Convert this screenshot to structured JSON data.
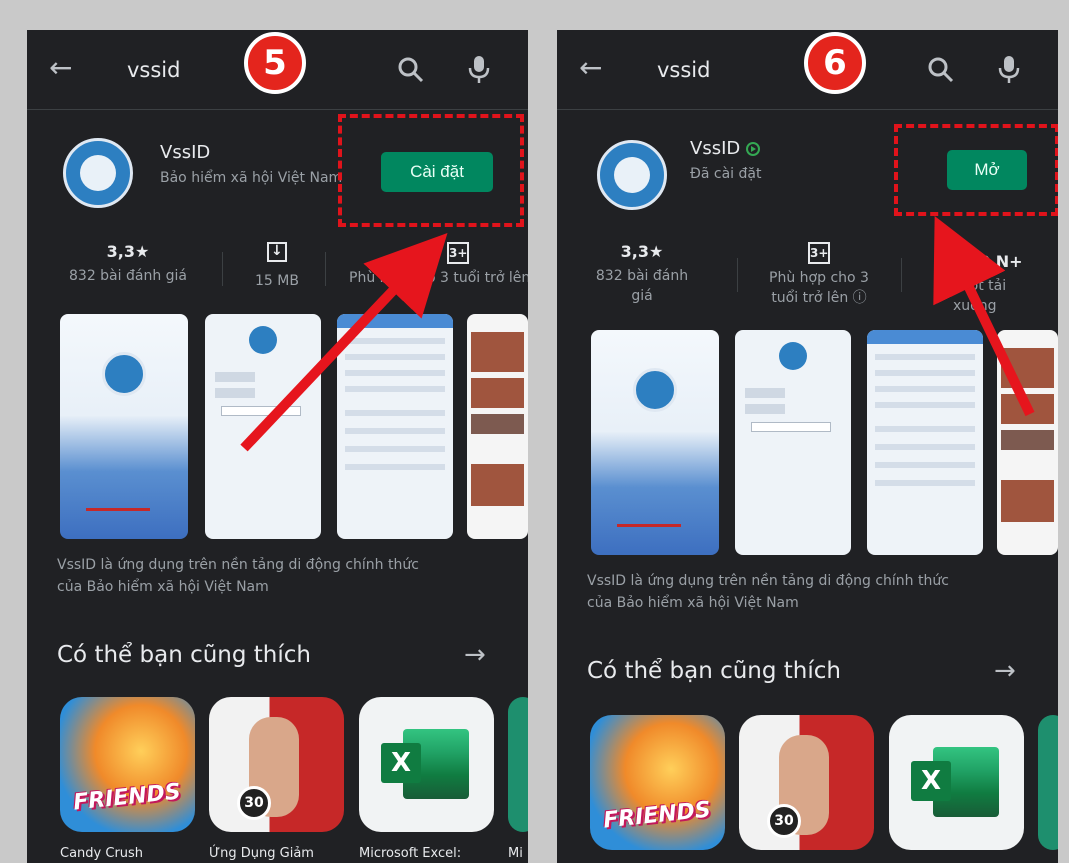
{
  "left": {
    "search_query": "vssid",
    "step": "5",
    "app_name": "VssID",
    "app_subtitle": "Bảo hiểm xã hội Việt Nam",
    "action_label": "Cài đặt",
    "rating": "3,3★",
    "reviews": "832 bài đánh giá",
    "size": "15 MB",
    "age_rating": "3+",
    "age_text": "Phù hợp cho 3 tuổi trở lên",
    "description_line1": "VssID là ứng dụng trên nền tảng di động chính thức",
    "description_line2": "của Bảo hiểm xã hội Việt Nam",
    "section_title": "Có thể bạn cũng thích",
    "recs": [
      "Candy Crush",
      "Ứng Dụng Giảm",
      "Microsoft Excel:",
      "Mi"
    ]
  },
  "right": {
    "search_query": "vssid",
    "step": "6",
    "app_name": "VssID",
    "app_subtitle": "Đã cài đặt",
    "action_label": "Mở",
    "rating": "3,3★",
    "reviews_line1": "832 bài đánh",
    "reviews_line2": "giá",
    "age_rating": "3+",
    "age_text_line1": "Phù hợp cho 3",
    "age_text_line2": "tuổi trở lên ⓘ",
    "downloads": "0 N+",
    "downloads_label": "Lượt tải xuống",
    "description_line1": "VssID là ứng dụng trên nền tảng di động chính thức",
    "description_line2": "của Bảo hiểm xã hội Việt Nam",
    "section_title": "Có thể bạn cũng thích"
  },
  "candy_badge_text": "FRIENDS",
  "fitness_badge_text": "30",
  "excel_badge_text": "X",
  "icons": {
    "back": "arrow-left-icon",
    "search": "search-icon",
    "mic": "mic-icon",
    "more": "arrow-right-icon"
  },
  "colors": {
    "background": "#202124",
    "install_green": "#01875f",
    "highlight_red": "#e0131b",
    "badge_red": "#e4251d"
  }
}
